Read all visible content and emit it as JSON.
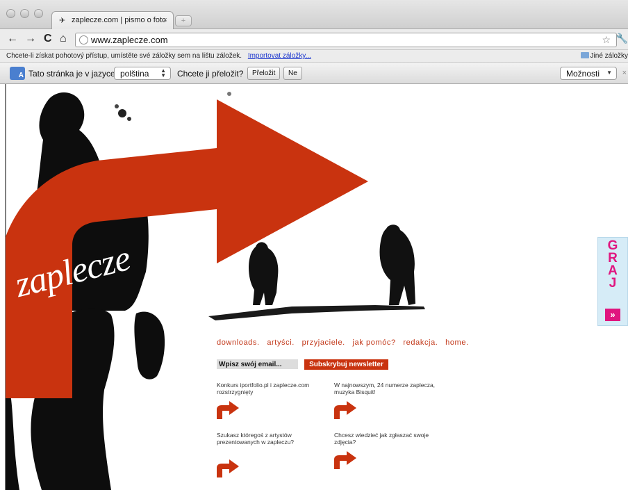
{
  "browser": {
    "tab": {
      "title": "zaplecze.com | pismo o foto",
      "close": "×"
    },
    "new_tab": "+",
    "nav": {
      "back": "←",
      "forward": "→",
      "reload": "C",
      "home": "⌂"
    },
    "url": "www.zaplecze.com",
    "bookmarks_bar": {
      "text": "Chcete-li získat pohotový přístup, umístěte své záložky sem na lištu záložek.",
      "import_link": "Importovat záložky...",
      "other": "Jiné záložky"
    },
    "translate_bar": {
      "icon_label": "A",
      "text1": "Tato stránka je v jazyce",
      "language": "polština",
      "text2": "Chcete ji přeložit?",
      "translate_btn": "Přeložit",
      "no_btn": "Ne",
      "options": "Možnosti",
      "close": "×"
    }
  },
  "site": {
    "logo": "zaplecze",
    "nav": [
      "downloads.",
      "artyści.",
      "przyjaciele.",
      "jak pomóc?",
      "redakcja.",
      "home."
    ],
    "email_placeholder": "Wpisz swój email...",
    "subscribe": "Subskrybuj newsletter",
    "news": [
      "Konkurs iportfolio.pl i zaplecze.com rozstrzygnięty",
      "W najnowszym, 24 numerze zaplecza, muzyka Bisquit!",
      "Szukasz któregoś z artystów prezentowanych w zapleczu?",
      "Chcesz wiedzieć jak zgłaszać swoje zdjęcia?"
    ],
    "graj": {
      "letters": [
        "G",
        "R",
        "A",
        "J"
      ],
      "button": "»"
    }
  },
  "colors": {
    "accent": "#c9330f",
    "graj": "#e0157f"
  }
}
